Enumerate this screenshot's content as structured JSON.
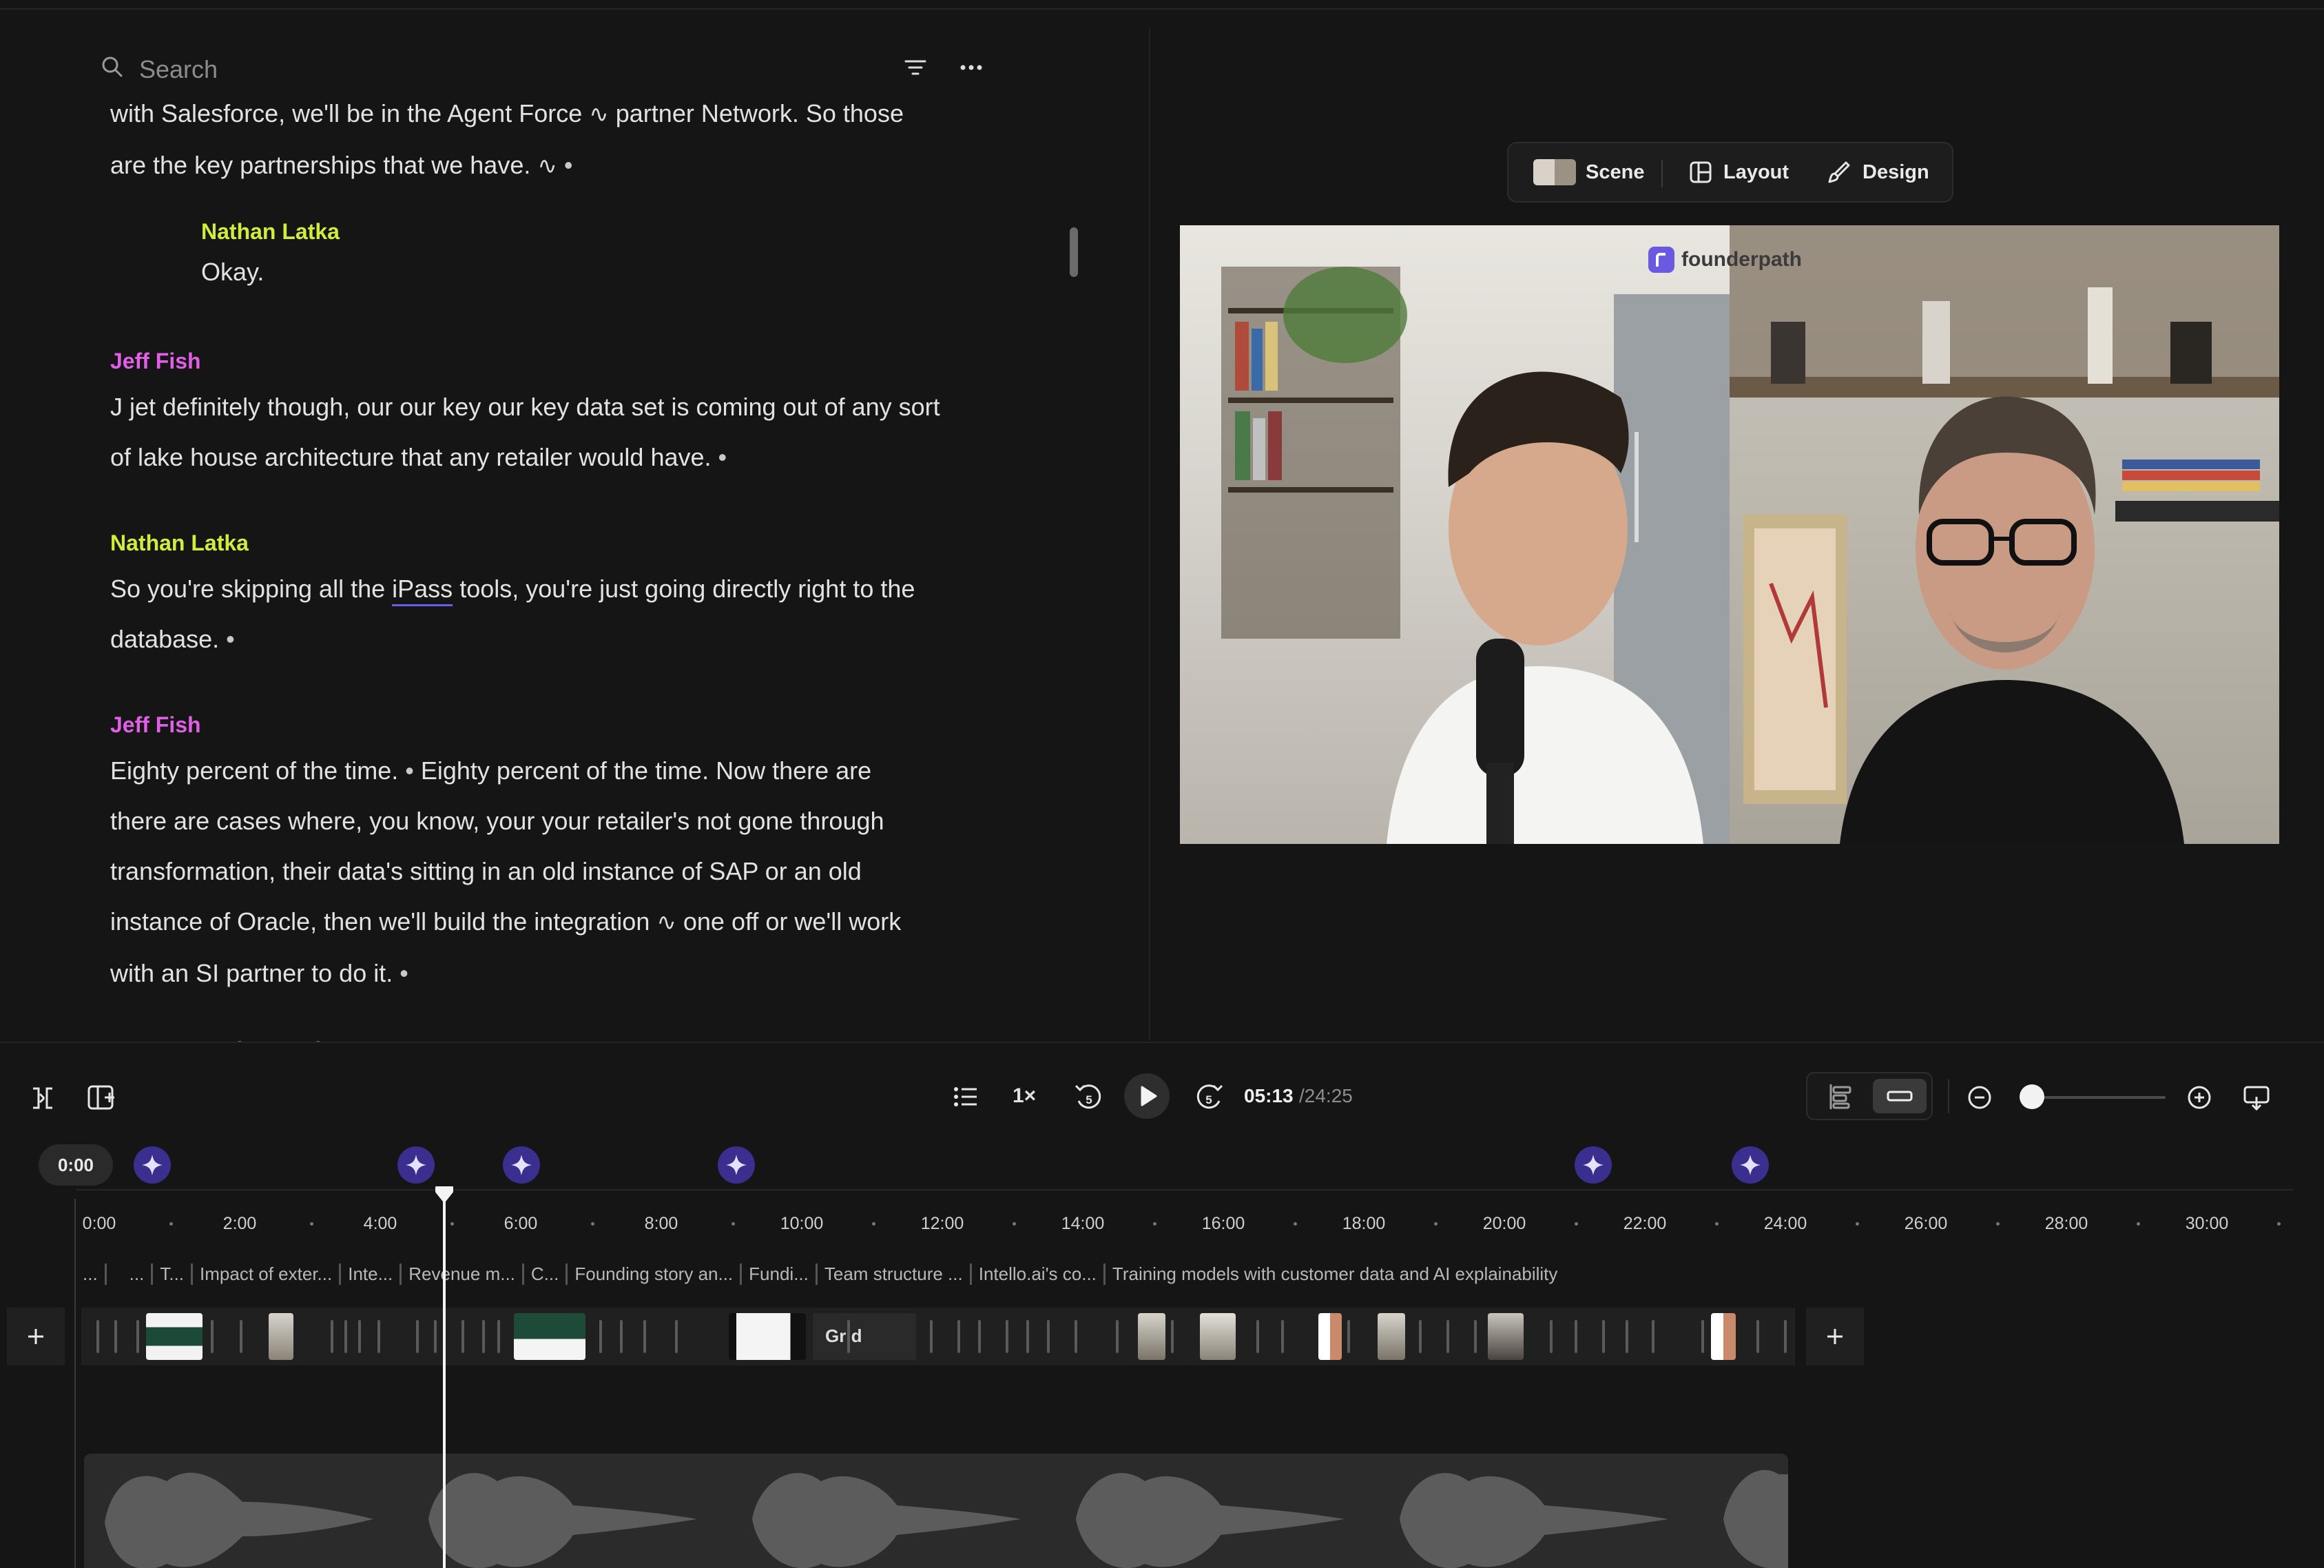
{
  "search": {
    "placeholder": "Search"
  },
  "transcript": {
    "b1": {
      "line1": "with Salesforce, we'll be in the Agent Force",
      "line1b": "partner Network. So those",
      "line2": "are the key partnerships that we have."
    },
    "b2": {
      "speaker": "Nathan Latka",
      "line1": "Okay."
    },
    "b3": {
      "speaker": "Jeff Fish",
      "line1": "J jet definitely though, our our key our key data set is coming out of any sort",
      "line2": "of lake house architecture that any retailer would have."
    },
    "b4": {
      "speaker": "Nathan Latka",
      "line1a": "So you're skipping all the",
      "line1u": "iPass",
      "line1b": "tools, you're just going directly right to the",
      "line2": "database."
    },
    "b5": {
      "speaker": "Jeff Fish",
      "line1a": "Eighty percent of the time.",
      "line1b": "Eighty percent of the time. Now there are",
      "line2": "there are cases where, you know,  your your retailer's not gone through",
      "line3": "transformation, their data's sitting in an old instance of SAP or an old",
      "line4a": "instance of Oracle, then we'll build the integration",
      "line4b": "one off or we'll work",
      "line5": "with an SI partner to do it."
    },
    "b6": {
      "speaker": "Nathan Latka"
    },
    "bullet": "•",
    "wave_glyph": "∿"
  },
  "preview": {
    "toolbar": {
      "scene": "Scene",
      "layout": "Layout",
      "design": "Design"
    },
    "brand": "founderpath"
  },
  "controls": {
    "speed": "1×",
    "rewind_seconds": "5",
    "forward_seconds": "5",
    "current_time": "05:13",
    "total_time": "/24:25",
    "zoom_level": 0.05
  },
  "timeline": {
    "start_pill": "0:00",
    "ticks": [
      "0:00",
      "2:00",
      "4:00",
      "6:00",
      "8:00",
      "10:00",
      "12:00",
      "14:00",
      "16:00",
      "18:00",
      "20:00",
      "22:00",
      "24:00",
      "26:00",
      "28:00",
      "30:00"
    ],
    "chapters": [
      "...",
      "",
      "...",
      "T...",
      "Impact of exter...",
      "Inte...",
      "Revenue m...",
      "C...",
      "Founding story an...",
      "Fundi...",
      "Team structure ...",
      "Intello.ai's co...",
      "Training models with customer data and AI explainability"
    ],
    "grid_label": "Grid",
    "playhead_time": "05:13"
  },
  "colors": {
    "background": "#151515",
    "speaker_nathan": "#d2ec3c",
    "speaker_jeff": "#e15ee6",
    "accent": "#6b5cf0",
    "sparkle": "#3a2f8e"
  }
}
